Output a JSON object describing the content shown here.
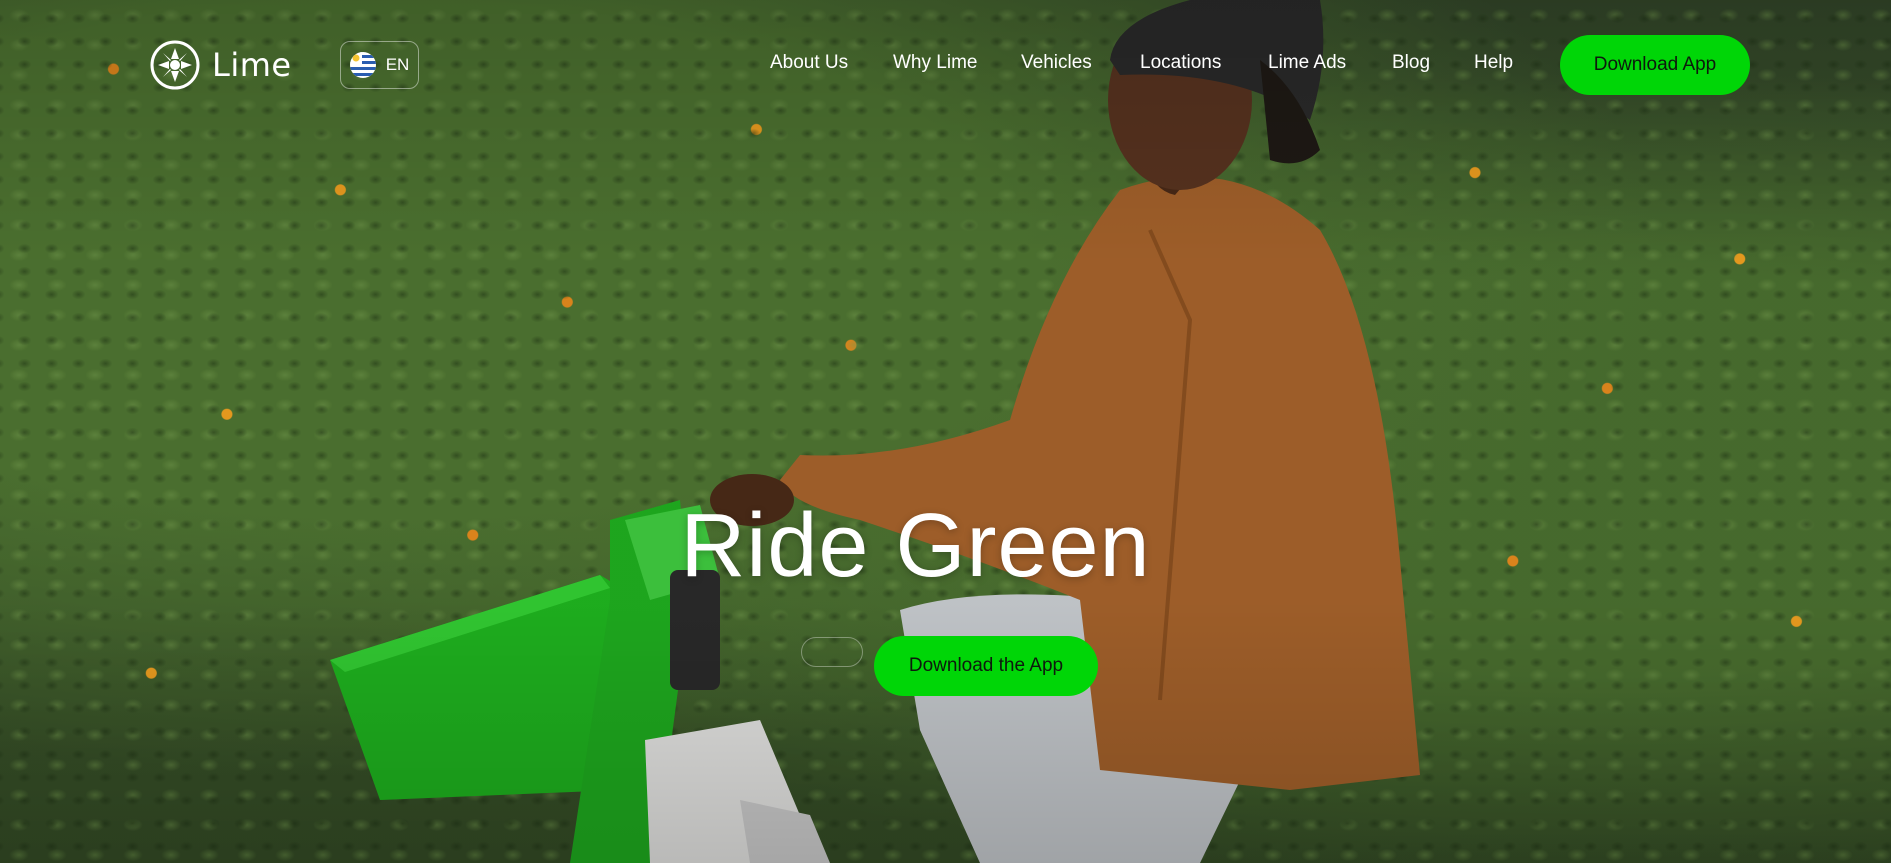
{
  "brand": {
    "name": "Lime",
    "wordmark": "Lime",
    "accent": "#00d607"
  },
  "language": {
    "code": "EN",
    "flag": "uruguay-flag"
  },
  "nav": {
    "items": [
      {
        "label": "About Us"
      },
      {
        "label": "Why Lime"
      },
      {
        "label": "Vehicles"
      },
      {
        "label": "Locations"
      },
      {
        "label": "Lime Ads"
      },
      {
        "label": "Blog"
      },
      {
        "label": "Help"
      }
    ],
    "cta_label": "Download App"
  },
  "hero": {
    "headline": "Ride Green",
    "cta_label": "Download the App"
  }
}
